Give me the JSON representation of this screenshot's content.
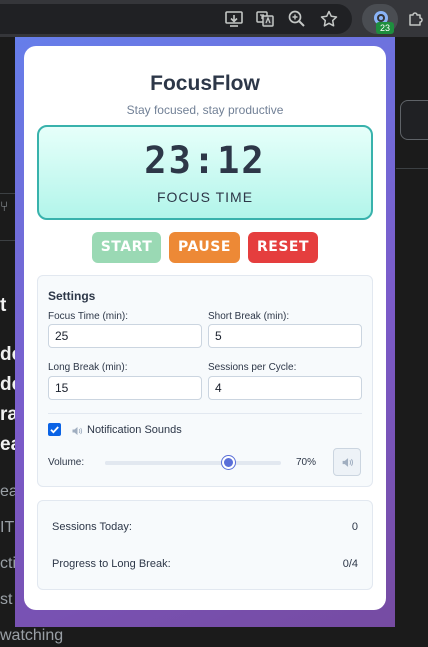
{
  "browser": {
    "toolbar_icons": [
      "install-app-icon",
      "translate-icon",
      "zoom-icon",
      "bookmark-star-icon",
      "extensions-puzzle-icon"
    ],
    "active_extension_badge": "23"
  },
  "background_page": {
    "lines": [
      "t",
      "de",
      "de",
      "ra",
      "ea",
      "ea",
      "IT",
      "cti",
      "st",
      "watching"
    ]
  },
  "popup": {
    "app_title": "FocusFlow",
    "subtitle": "Stay focused, stay productive",
    "timer": {
      "time": "23:12",
      "mode_label": "FOCUS TIME"
    },
    "controls": {
      "start_label": "START",
      "pause_label": "PAUSE",
      "reset_label": "RESET"
    },
    "settings": {
      "heading": "Settings",
      "focus_time_label": "Focus Time (min):",
      "focus_time_value": "25",
      "short_break_label": "Short Break (min):",
      "short_break_value": "5",
      "long_break_label": "Long Break (min):",
      "long_break_value": "15",
      "sessions_label": "Sessions per Cycle:",
      "sessions_value": "4",
      "notification_sounds_label": "Notification Sounds",
      "notification_sounds_checked": true,
      "volume_label": "Volume:",
      "volume_level": 0.7,
      "volume_text": "70%"
    },
    "stats": {
      "sessions_today_label": "Sessions Today:",
      "sessions_today_value": "0",
      "progress_label": "Progress to Long Break:",
      "progress_value": "0/4"
    }
  },
  "colors": {
    "gradient_start": "#667eea",
    "gradient_end": "#764ba2",
    "timer_border": "#38b2ac",
    "start": "#48bb78",
    "pause": "#ed8936",
    "reset": "#e53e3e",
    "slider_thumb": "#5a6fd8"
  }
}
